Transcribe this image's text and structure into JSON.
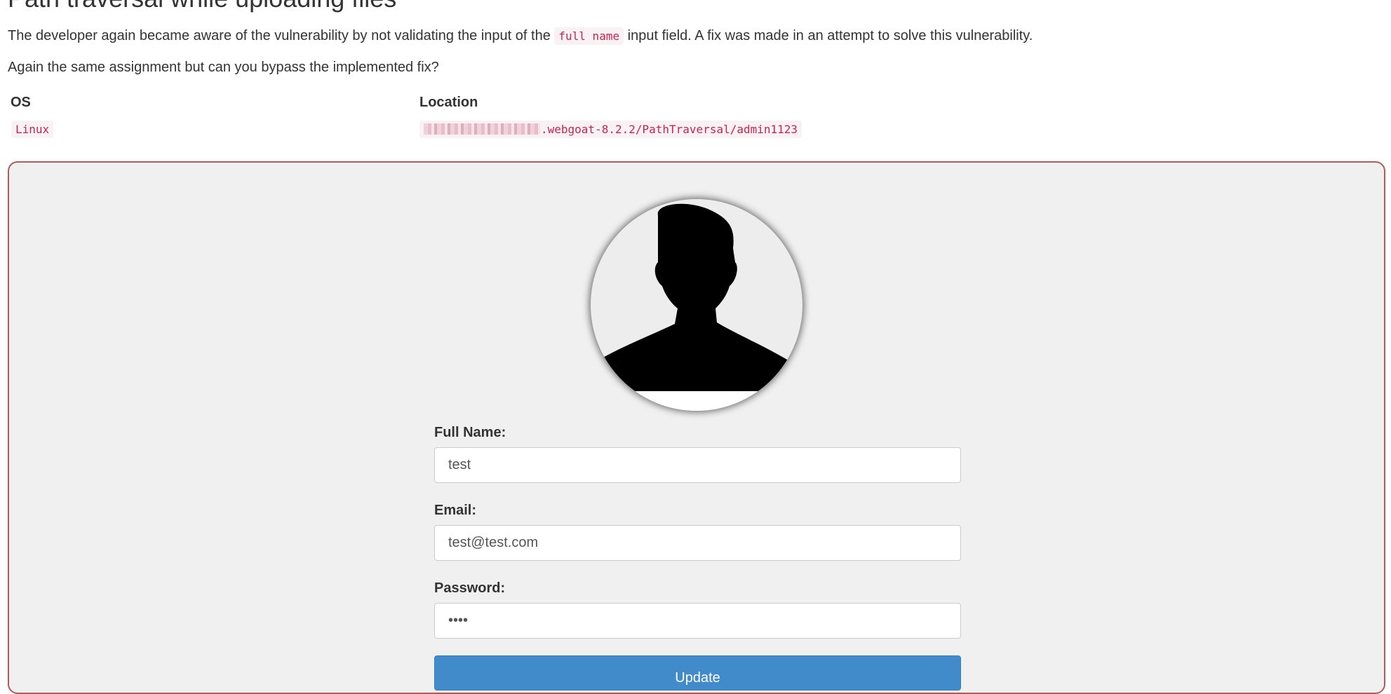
{
  "page": {
    "title": "Path traversal while uploading files",
    "para1_before": "The developer again became aware of the vulnerability by not validating the input of the ",
    "para1_code": "full name",
    "para1_after": " input field. A fix was made in an attempt to solve this vulnerability.",
    "para2": "Again the same assignment but can you bypass the implemented fix?"
  },
  "table": {
    "headers": [
      "OS",
      "Location"
    ],
    "rows": [
      {
        "os": "Linux",
        "location": ".webgoat-8.2.2/PathTraversal/admin1123"
      }
    ]
  },
  "profile": {
    "avatar_icon": "user-silhouette-icon",
    "full_name_label": "Full Name:",
    "full_name_value": "test",
    "email_label": "Email:",
    "email_value": "test@test.com",
    "password_label": "Password:",
    "password_value": "test",
    "submit_label": "Update"
  },
  "colors": {
    "code_text": "#c7254e",
    "code_bg": "#f9f2f4",
    "panel_border": "#b15b5b",
    "panel_bg": "#f0f0f0",
    "button_bg": "#428bca"
  }
}
